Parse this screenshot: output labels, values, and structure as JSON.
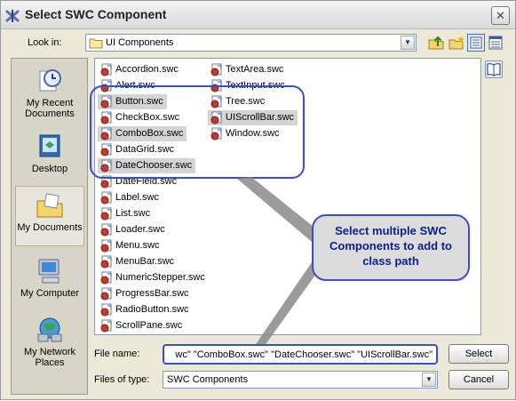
{
  "window": {
    "title": "Select SWC Component",
    "close": "✕"
  },
  "toolbar": {
    "lookin_label": "Look in:",
    "lookin_value": "UI Components",
    "tools": [
      "up-folder-icon",
      "new-folder-icon",
      "list-view-icon",
      "details-view-icon"
    ]
  },
  "places": [
    {
      "label_line1": "My Recent",
      "label_line2": "Documents",
      "icon": "recent-documents-icon"
    },
    {
      "label_line1": "Desktop",
      "label_line2": "",
      "icon": "desktop-icon"
    },
    {
      "label_line1": "My Documents",
      "label_line2": "",
      "icon": "my-documents-icon"
    },
    {
      "label_line1": "My Computer",
      "label_line2": "",
      "icon": "my-computer-icon"
    },
    {
      "label_line1": "My Network",
      "label_line2": "Places",
      "icon": "network-places-icon"
    }
  ],
  "files_col1": [
    {
      "name": "Accordion.swc",
      "selected": false
    },
    {
      "name": "Alert.swc",
      "selected": false
    },
    {
      "name": "Button.swc",
      "selected": true
    },
    {
      "name": "CheckBox.swc",
      "selected": false
    },
    {
      "name": "ComboBox.swc",
      "selected": true
    },
    {
      "name": "DataGrid.swc",
      "selected": false
    },
    {
      "name": "DateChooser.swc",
      "selected": true
    },
    {
      "name": "DateField.swc",
      "selected": false
    },
    {
      "name": "Label.swc",
      "selected": false
    },
    {
      "name": "List.swc",
      "selected": false
    },
    {
      "name": "Loader.swc",
      "selected": false
    },
    {
      "name": "Menu.swc",
      "selected": false
    },
    {
      "name": "MenuBar.swc",
      "selected": false
    },
    {
      "name": "NumericStepper.swc",
      "selected": false
    },
    {
      "name": "ProgressBar.swc",
      "selected": false
    },
    {
      "name": "RadioButton.swc",
      "selected": false
    },
    {
      "name": "ScrollPane.swc",
      "selected": false
    }
  ],
  "files_col2": [
    {
      "name": "TextArea.swc",
      "selected": false
    },
    {
      "name": "TextInput.swc",
      "selected": false
    },
    {
      "name": "Tree.swc",
      "selected": false
    },
    {
      "name": "UIScrollBar.swc",
      "selected": true
    },
    {
      "name": "Window.swc",
      "selected": false
    }
  ],
  "callout": {
    "line1": "Select multiple SWC",
    "line2": "Components to add to",
    "line3": "class path"
  },
  "form": {
    "file_name_label": "File name:",
    "file_name_value": "wc\" \"ComboBox.swc\" \"DateChooser.swc\" \"UIScrollBar.swc\"",
    "file_type_label": "Files of type:",
    "file_type_value": "SWC Components",
    "select_button": "Select",
    "cancel_button": "Cancel"
  },
  "colors": {
    "accent": "#3c4bd4",
    "callout_text": "#0c1f8a",
    "selection": "#d4d4d4"
  }
}
